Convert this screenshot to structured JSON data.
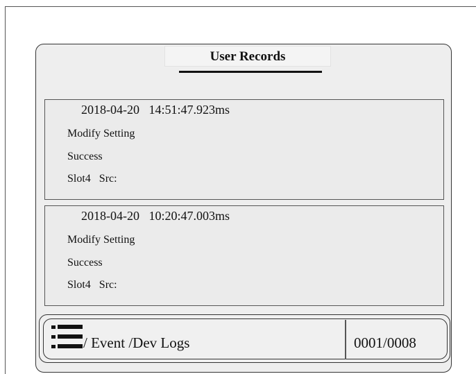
{
  "header": {
    "title": "User Records"
  },
  "records": [
    {
      "timestamp": "2018-04-20   14:51:47.923ms",
      "action": "Modify Setting",
      "result": "Success",
      "source": "Slot4   Src:"
    },
    {
      "timestamp": "2018-04-20   10:20:47.003ms",
      "action": "Modify Setting",
      "result": "Success",
      "source": "Slot4   Src:"
    }
  ],
  "footer": {
    "menu_icon": "list-menu-icon",
    "nav_text": "/ Event /Dev Logs",
    "page_counter": "0001/0008"
  }
}
